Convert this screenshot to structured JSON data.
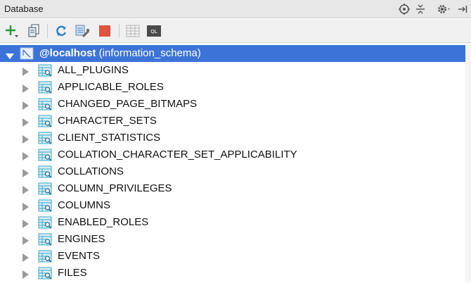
{
  "window": {
    "title": "Database"
  },
  "header_icons": [
    "target-icon",
    "collapse-icon",
    "gear-icon",
    "hide-icon"
  ],
  "toolbar": {
    "buttons": [
      "add-icon",
      "copy-icon",
      "refresh-icon",
      "properties-icon",
      "stop-icon",
      "table-icon",
      "console-icon"
    ]
  },
  "tree": {
    "root": {
      "name": "@localhost",
      "schema": "(information_schema)"
    },
    "items": [
      "ALL_PLUGINS",
      "APPLICABLE_ROLES",
      "CHANGED_PAGE_BITMAPS",
      "CHARACTER_SETS",
      "CLIENT_STATISTICS",
      "COLLATION_CHARACTER_SET_APPLICABILITY",
      "COLLATIONS",
      "COLUMN_PRIVILEGES",
      "COLUMNS",
      "ENABLED_ROLES",
      "ENGINES",
      "EVENTS",
      "FILES"
    ]
  },
  "colors": {
    "selection": "#3b73d8",
    "table_icon": "#3aa6c8"
  }
}
